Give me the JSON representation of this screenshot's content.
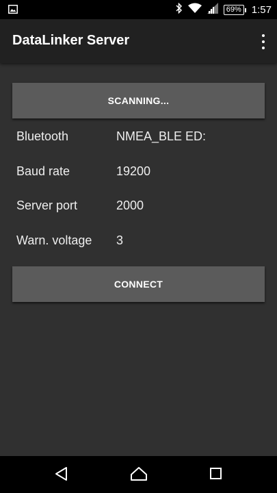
{
  "status_bar": {
    "battery": "69%",
    "time": "1:57",
    "icons": [
      "image-icon",
      "bluetooth-icon",
      "wifi-icon",
      "signal-icon",
      "battery-icon"
    ]
  },
  "app_bar": {
    "title": "DataLinker Server",
    "menu_icon": "overflow-menu-icon"
  },
  "scan_button": {
    "label": "SCANNING..."
  },
  "settings": [
    {
      "label": "Bluetooth",
      "value": "NMEA_BLE ED:"
    },
    {
      "label": "Baud rate",
      "value": "19200"
    },
    {
      "label": "Server port",
      "value": "2000"
    },
    {
      "label": "Warn. voltage",
      "value": "3"
    }
  ],
  "connect_button": {
    "label": "CONNECT"
  },
  "nav_bar": {
    "icons": [
      "back-icon",
      "home-icon",
      "recents-icon"
    ]
  },
  "colors": {
    "background": "#303030",
    "app_bar": "#212121",
    "button": "#5b5b5b",
    "system_bars": "#000000"
  }
}
